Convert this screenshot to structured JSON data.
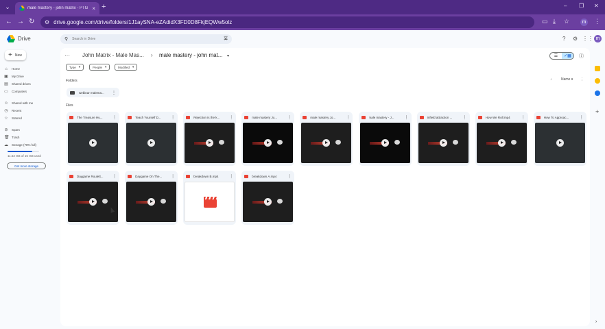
{
  "browser": {
    "tab_title": "male mastery - john matrix - PTG - G",
    "url": "drive.google.com/drive/folders/1J1aySNA-eZAdidX3FD0D8FkjEQWw5olz",
    "profile_initial": "m",
    "frame_color": "#4e2a84"
  },
  "drive": {
    "logo_text": "Drive",
    "search_placeholder": "Search in Drive",
    "new_label": "New",
    "avatar_initial": "m"
  },
  "sidebar": {
    "items": [
      {
        "label": "Home",
        "icon": "home-icon"
      },
      {
        "label": "My Drive",
        "icon": "drive-icon"
      },
      {
        "label": "Shared drives",
        "icon": "shared-drives-icon"
      },
      {
        "label": "Computers",
        "icon": "computer-icon"
      },
      {
        "label": "Shared with me",
        "icon": "people-icon"
      },
      {
        "label": "Recent",
        "icon": "clock-icon"
      },
      {
        "label": "Starred",
        "icon": "star-icon"
      },
      {
        "label": "Spam",
        "icon": "spam-icon"
      },
      {
        "label": "Trash",
        "icon": "trash-icon"
      },
      {
        "label": "Storage (78% full)",
        "icon": "cloud-icon"
      }
    ],
    "storage_used": 0.78,
    "storage_text": "11.52 GB of 15 GB used",
    "get_storage": "Get more storage"
  },
  "breadcrumb": {
    "parent": "John Matrix - Male Mas...",
    "current": "male mastery - john mat..."
  },
  "filters": [
    "Type",
    "People",
    "Modified"
  ],
  "sections": {
    "folders": "Folders",
    "files": "Files",
    "sort_label": "Name"
  },
  "folders": [
    {
      "name": "webinar malema..."
    }
  ],
  "files": [
    {
      "name": "The Treasure Hu...",
      "thumb": "grey"
    },
    {
      "name": "Teach Yourself D...",
      "thumb": "grey"
    },
    {
      "name": "Rejection is the k...",
      "thumb": "dark"
    },
    {
      "name": "male mastery Jo...",
      "thumb": "black"
    },
    {
      "name": "male mastery Jo...",
      "thumb": "dark"
    },
    {
      "name": "male mastery - J...",
      "thumb": "black"
    },
    {
      "name": "Infield attraction ...",
      "thumb": "dark"
    },
    {
      "name": "How We Roll.mp4",
      "thumb": "dark"
    },
    {
      "name": "How To Approac...",
      "thumb": "grey"
    },
    {
      "name": "Daygame Roulett...",
      "thumb": "dark"
    },
    {
      "name": "Daygame On The...",
      "thumb": "dark"
    },
    {
      "name": "breakdown B.mp4",
      "thumb": "white"
    },
    {
      "name": "breakdown A.mp4",
      "thumb": "dark"
    }
  ]
}
